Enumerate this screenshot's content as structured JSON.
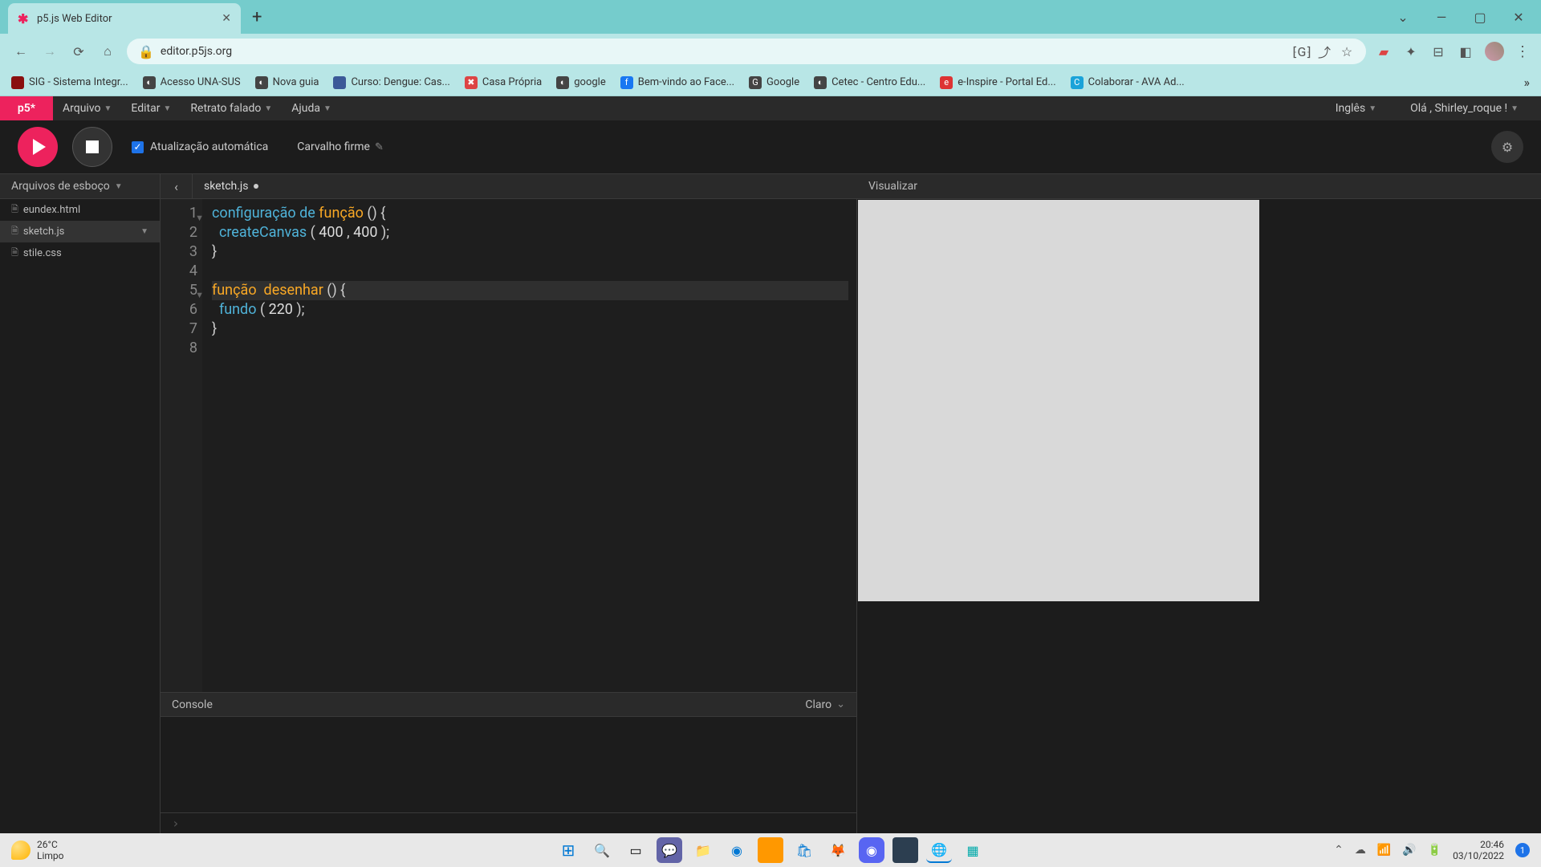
{
  "browser": {
    "tab_title": "p5.js Web Editor",
    "url": "editor.p5js.org",
    "bookmarks": [
      {
        "label": "SIG - Sistema Integr...",
        "icon_bg": "#8a1010",
        "icon_letter": " "
      },
      {
        "label": "Acesso UNA-SUS",
        "icon_bg": "#444",
        "icon_letter": "◐"
      },
      {
        "label": "Nova guia",
        "icon_bg": "#444",
        "icon_letter": "◐"
      },
      {
        "label": "Curso: Dengue: Cas...",
        "icon_bg": "#3b5998",
        "icon_letter": " "
      },
      {
        "label": "Casa Própria",
        "icon_bg": "#d44",
        "icon_letter": "✖"
      },
      {
        "label": "google",
        "icon_bg": "#444",
        "icon_letter": "◐"
      },
      {
        "label": "Bem-vindo ao Face...",
        "icon_bg": "#1877f2",
        "icon_letter": "f"
      },
      {
        "label": "Google",
        "icon_bg": "#444",
        "icon_letter": "G"
      },
      {
        "label": "Cetec - Centro Edu...",
        "icon_bg": "#444",
        "icon_letter": "◐"
      },
      {
        "label": "e-Inspire - Portal Ed...",
        "icon_bg": "#d33",
        "icon_letter": "e"
      },
      {
        "label": "Colaborar - AVA Ad...",
        "icon_bg": "#1aa3d9",
        "icon_letter": "C"
      }
    ]
  },
  "p5": {
    "logo": "p5*",
    "menu": {
      "arquivo": "Arquivo",
      "editar": "Editar",
      "retrato": "Retrato falado",
      "ajuda": "Ajuda"
    },
    "lang": "Inglês",
    "greeting": "Olá , Shirley_roque !",
    "auto_refresh_label": "Atualização automática",
    "sketch_name": "Carvalho firme",
    "files_label": "Arquivos de esboço",
    "current_file": "sketch.js",
    "files": [
      "eundex.html",
      "sketch.js",
      "stile.css"
    ],
    "preview_label": "Visualizar",
    "console_label": "Console",
    "console_right": "Claro"
  },
  "code": {
    "l1_a": "configuração",
    "l1_b": " de ",
    "l1_c": "função",
    "l1_d": " () {",
    "l2_a": "  ",
    "l2_b": "createCanvas",
    "l2_c": " ( ",
    "l2_d": "400",
    "l2_e": " , ",
    "l2_f": "400",
    "l2_g": " );",
    "l3": "}",
    "l4": "",
    "l5_a": "função",
    "l5_b": "  ",
    "l5_c": "desenhar",
    "l5_d": " () {",
    "l6_a": "  ",
    "l6_b": "fundo",
    "l6_c": " ( ",
    "l6_d": "220",
    "l6_e": " );",
    "l7": "}",
    "l8": ""
  },
  "taskbar": {
    "temp": "26°C",
    "cond": "Limpo",
    "time": "20:46",
    "date": "03/10/2022",
    "notif": "1"
  }
}
